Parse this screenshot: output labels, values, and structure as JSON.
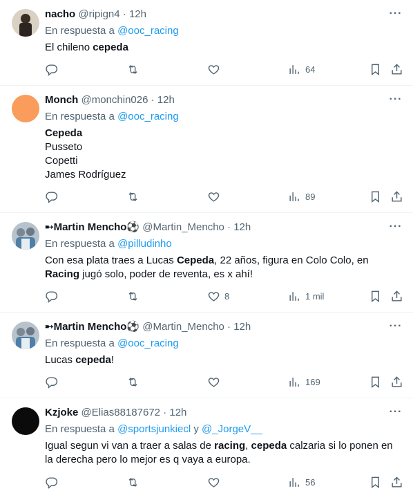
{
  "tweets": [
    {
      "name": "nacho",
      "handle": "@ripign4",
      "dot": "·",
      "time": "12h",
      "reply_prefix": "En respuesta a",
      "reply_to": "@ooc_racing",
      "reply_joiner": "",
      "reply_to2": "",
      "lines": [
        [
          "El chileno ",
          "cepeda"
        ]
      ],
      "views": "64",
      "likes": "",
      "avatar_color": "#5a4a3a"
    },
    {
      "name": "Monch",
      "handle": "@monchin026",
      "dot": "·",
      "time": "12h",
      "reply_prefix": "En respuesta a",
      "reply_to": "@ooc_racing",
      "lines": [
        [
          "",
          "Cepeda"
        ],
        [
          "Pusseto",
          ""
        ],
        [
          "Copetti",
          ""
        ],
        [
          "James Rodríguez",
          ""
        ]
      ],
      "views": "89",
      "likes": "",
      "avatar_color": "#fa9c5b"
    },
    {
      "name": "➸Martin Mencho⚽",
      "handle": "@Martin_Mencho",
      "dot": "·",
      "time": "12h",
      "reply_prefix": "En respuesta a",
      "reply_to": "@pilludinho",
      "lines": [
        [
          "Con esa plata traes a Lucas ",
          "Cepeda",
          ", 22 años, figura en Colo Colo, en"
        ],
        [
          "",
          "Racing",
          " jugó solo, poder de reventa, es x ahí!"
        ]
      ],
      "views": "1 mil",
      "likes": "8",
      "avatar_color": "#8a9aa8"
    },
    {
      "name": "➸Martin Mencho⚽",
      "handle": "@Martin_Mencho",
      "dot": "·",
      "time": "12h",
      "reply_prefix": "En respuesta a",
      "reply_to": "@ooc_racing",
      "lines": [
        [
          "Lucas ",
          "cepeda",
          "!"
        ]
      ],
      "views": "169",
      "likes": "",
      "avatar_color": "#8a9aa8"
    },
    {
      "name": "Kzjoke",
      "handle": "@Elias88187672",
      "dot": "·",
      "time": "12h",
      "reply_prefix": "En respuesta a",
      "reply_to": "@sportsjunkiecl",
      "reply_joiner": " y ",
      "reply_to2": "@_JorgeV__",
      "lines": [
        [
          "Igual segun vi van a traer a salas de ",
          "racing",
          ", "
        ],
        [
          "la derecha pero lo mejor es q vaya a europa.",
          "",
          ""
        ]
      ],
      "line1_extra_bold": "cepeda",
      "line1_extra_tail": " calzaria si lo ponen en",
      "views": "56",
      "likes": "",
      "avatar_color": "#0b0b0b"
    }
  ],
  "icons": [
    "reply-icon",
    "retweet-icon",
    "like-icon",
    "views-icon",
    "bookmark-icon",
    "share-icon"
  ],
  "colors": {
    "text": "#0f1419",
    "muted": "#536471",
    "link": "#1d9bf0",
    "border": "#eff3f4"
  }
}
